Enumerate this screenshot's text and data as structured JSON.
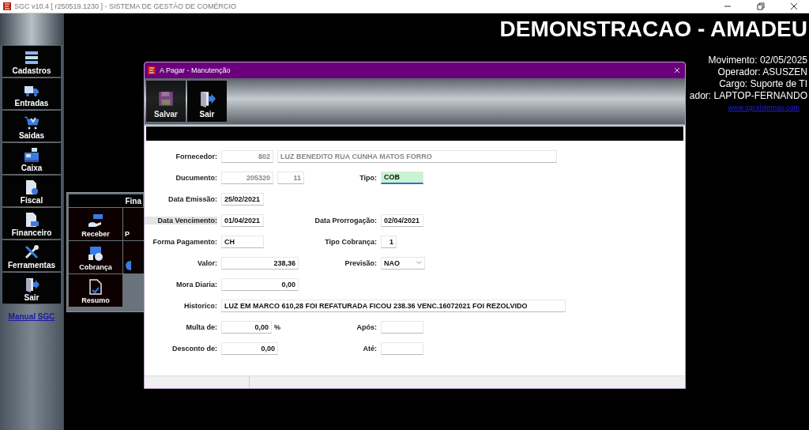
{
  "window": {
    "title": "SGC v10.4 [ r250519.1230 ] - SISTEMA DE GESTÃO DE COMÉRCIO"
  },
  "sidebar": {
    "items": [
      {
        "label": "Cadastros"
      },
      {
        "label": "Entradas"
      },
      {
        "label": "Saidas"
      },
      {
        "label": "Caixa"
      },
      {
        "label": "Fiscal"
      },
      {
        "label": "Financeiro"
      },
      {
        "label": "Ferramentas"
      },
      {
        "label": "Sair"
      }
    ],
    "link": "Manual SGC"
  },
  "company": "DEMONSTRACAO - AMADEU",
  "session": [
    "Movimento: 02/05/2025",
    "Operador: ASUSZEN",
    "Cargo: Suporte de TI",
    "ador: LAPTOP-FERNANDO"
  ],
  "website": "www.sgcsistemas.com",
  "finance_panel": {
    "title": "Fina",
    "tiles": [
      {
        "label": "Receber"
      },
      {
        "label": "P"
      },
      {
        "label": "Cobrança"
      },
      {
        "kind": "icon-only"
      },
      {
        "label": "Resumo"
      }
    ]
  },
  "dialog": {
    "title": "A Pagar - Manutenção",
    "toolbar": [
      {
        "label": "Salvar",
        "disabled": true
      },
      {
        "label": "Sair",
        "disabled": false
      }
    ],
    "rows": [
      {
        "left": {
          "label": "Fornecedor:",
          "highlighted": false,
          "fields": [
            {
              "kind": "code",
              "value": "802",
              "focused": false,
              "disabled": true
            },
            {
              "kind": "name",
              "value": "LUZ BENEDITO RUA CUNHA MATOS FORRO",
              "focused": false,
              "disabled": true
            }
          ]
        }
      },
      {
        "left": {
          "label": "Ducumento:",
          "highlighted": false,
          "fields": [
            {
              "kind": "code",
              "value": "205320",
              "focused": false,
              "disabled": true
            },
            {
              "kind": "tiny",
              "value": "11",
              "focused": false,
              "disabled": true
            }
          ]
        },
        "right": {
          "label": "Tipo:",
          "highlighted": false,
          "fields": [
            {
              "kind": "date",
              "value": "COB",
              "focused": true
            }
          ]
        }
      },
      {
        "left": {
          "label": "Data Emissão:",
          "highlighted": false,
          "fields": [
            {
              "kind": "date",
              "value": "25/02/2021",
              "focused": false
            }
          ]
        }
      },
      {
        "left": {
          "label": "Data Vencimento:",
          "highlighted": true,
          "fields": [
            {
              "kind": "date",
              "value": "01/04/2021",
              "focused": false
            }
          ]
        },
        "right": {
          "label": "Data Prorrogação:",
          "highlighted": false,
          "fields": [
            {
              "kind": "date",
              "value": "02/04/2021",
              "focused": false
            }
          ]
        }
      },
      {
        "left": {
          "label": "Forma Pagamento:",
          "highlighted": false,
          "fields": [
            {
              "kind": "date",
              "value": "CH",
              "focused": false
            }
          ]
        },
        "right": {
          "label": "Tipo Cobrança:",
          "highlighted": false,
          "fields": [
            {
              "kind": "digit",
              "value": "1",
              "focused": false
            }
          ]
        }
      },
      {
        "left": {
          "label": "Valor:",
          "highlighted": false,
          "fields": [
            {
              "kind": "money",
              "value": "238,36",
              "focused": false
            }
          ]
        },
        "right": {
          "label": "Previsão:",
          "highlighted": false,
          "fields": [
            {
              "kind": "select",
              "value": "NAO",
              "focused": false
            }
          ]
        }
      },
      {
        "left": {
          "label": "Mora Diaria:",
          "highlighted": false,
          "fields": [
            {
              "kind": "money",
              "value": "0,00",
              "focused": false
            }
          ]
        }
      },
      {
        "left": {
          "label": "Historico:",
          "highlighted": false,
          "fields": [
            {
              "kind": "memo",
              "value": "LUZ EM MARCO 610,28 FOI REFATURADA FICOU 238.36 VENC.16072021 FOI REZOLVIDO",
              "focused": false
            }
          ]
        }
      },
      {
        "left": {
          "label": "Multa de:",
          "highlighted": false,
          "fields": [
            {
              "kind": "rate",
              "value": "0,00",
              "focused": false
            }
          ],
          "suffix": "%"
        },
        "right": {
          "label": "Após:",
          "highlighted": false,
          "fields": [
            {
              "kind": "date",
              "focused": false
            }
          ]
        }
      },
      {
        "left": {
          "label": "Desconto de:",
          "highlighted": false,
          "fields": [
            {
              "kind": "rate2",
              "value": "0,00",
              "focused": false
            }
          ]
        },
        "right": {
          "label": "Até:",
          "highlighted": false,
          "fields": [
            {
              "kind": "date",
              "focused": false
            }
          ]
        }
      }
    ]
  }
}
